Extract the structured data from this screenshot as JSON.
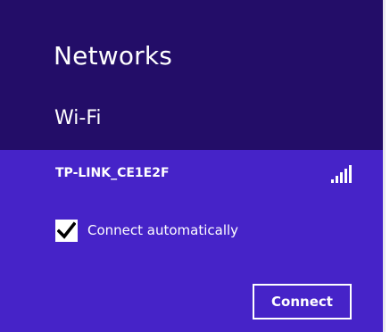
{
  "flyout": {
    "title": "Networks",
    "section_label": "Wi-Fi",
    "network": {
      "ssid": "TP-LINK_CE1E2F",
      "signal_icon": "wifi-signal-bars-icon",
      "signal_bars": 5,
      "signal_bars_filled": 5
    },
    "connect_automatically": {
      "label": "Connect automatically",
      "checked": true
    },
    "connect_button_label": "Connect"
  },
  "colors": {
    "header_background": "#230d68",
    "accent_background": "#4623c8",
    "text": "#ffffff"
  }
}
